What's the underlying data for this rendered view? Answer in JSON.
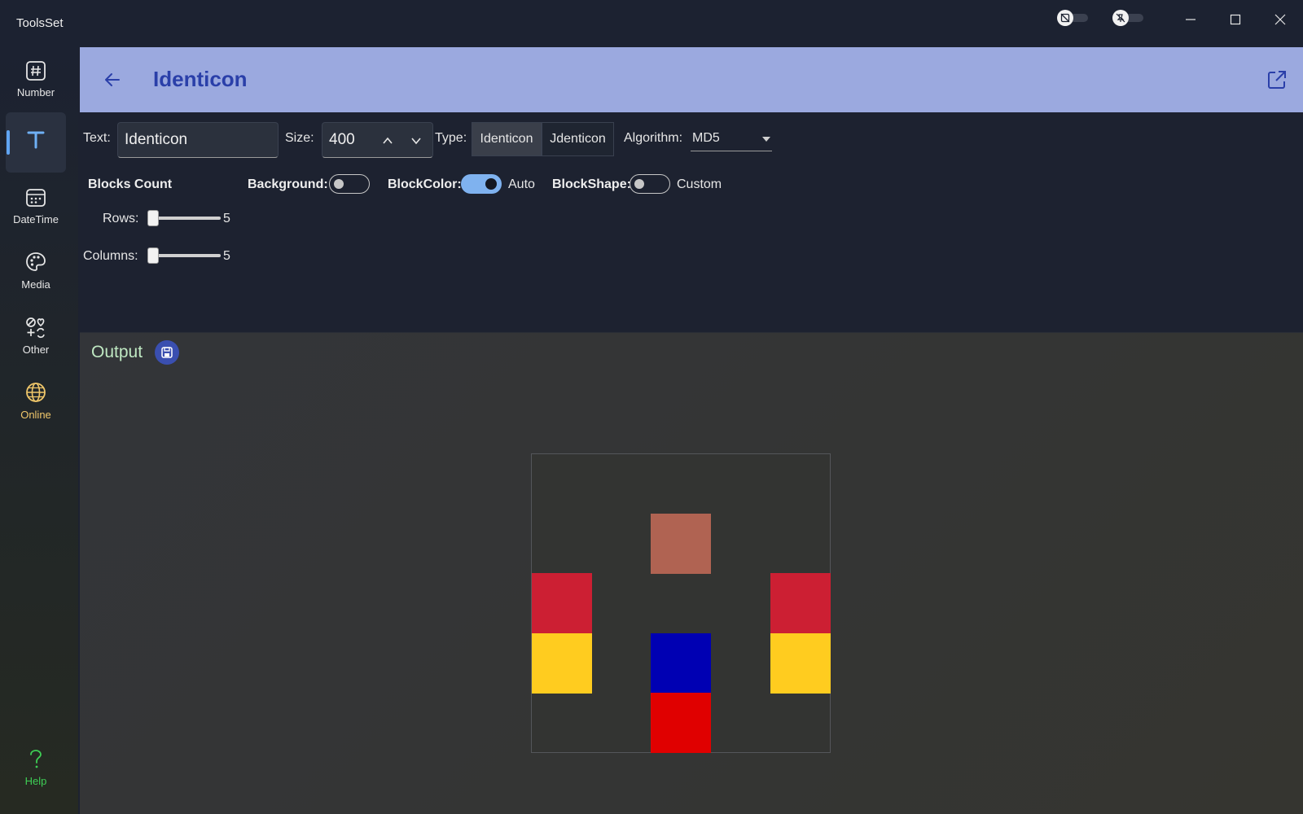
{
  "app": {
    "title": "ToolsSet"
  },
  "titlebar": {
    "toggles": [
      {
        "icon": "compact-overlay-off-icon"
      },
      {
        "icon": "pin-off-icon"
      }
    ],
    "buttons": {
      "minimize": "minimize-icon",
      "maximize": "maximize-icon",
      "close": "close-icon"
    }
  },
  "sidebar": {
    "items": [
      {
        "label": "Number",
        "icon": "hash-icon"
      },
      {
        "label": "Text",
        "icon": "text-icon",
        "active": true
      },
      {
        "label": "DateTime",
        "icon": "calendar-icon"
      },
      {
        "label": "Media",
        "icon": "palette-icon"
      },
      {
        "label": "Other",
        "icon": "other-tools-icon"
      },
      {
        "label": "Online",
        "icon": "globe-icon"
      }
    ],
    "help": {
      "label": "Help",
      "icon": "question-icon"
    }
  },
  "colors": {
    "header_bg": "#9ba9df",
    "title_color": "#2a3fa9",
    "accent": "#7fb2ef",
    "online_color": "#f0c76a",
    "help_color": "#3ecf55"
  },
  "header": {
    "title": "Identicon"
  },
  "options": {
    "text_label": "Text:",
    "text_value": "Identicon",
    "size_label": "Size:",
    "size_value": "400",
    "type_label": "Type:",
    "type_options": [
      "Identicon",
      "Jdenticon"
    ],
    "type_selected": "Identicon",
    "algorithm_label": "Algorithm:",
    "algorithm_value": "MD5",
    "blocks_count_label": "Blocks Count",
    "background_label": "Background:",
    "background_on": false,
    "blockcolor_label": "BlockColor:",
    "blockcolor_on": true,
    "blockcolor_state": "Auto",
    "blockshape_label": "BlockShape:",
    "blockshape_on": false,
    "blockshape_state": "Custom",
    "rows_label": "Rows:",
    "rows_value": "5",
    "columns_label": "Columns:",
    "columns_value": "5"
  },
  "output": {
    "title": "Output",
    "grid": {
      "rows": 5,
      "cols": 5,
      "cells": [
        {
          "row": 1,
          "col": 2,
          "color": "#b06352"
        },
        {
          "row": 2,
          "col": 0,
          "color": "#cc1f33"
        },
        {
          "row": 2,
          "col": 4,
          "color": "#cc1f33"
        },
        {
          "row": 3,
          "col": 0,
          "color": "#ffcc1f"
        },
        {
          "row": 3,
          "col": 4,
          "color": "#ffcc1f"
        },
        {
          "row": 3,
          "col": 2,
          "color": "#0000b3"
        },
        {
          "row": 4,
          "col": 2,
          "color": "#e00000"
        }
      ]
    }
  }
}
